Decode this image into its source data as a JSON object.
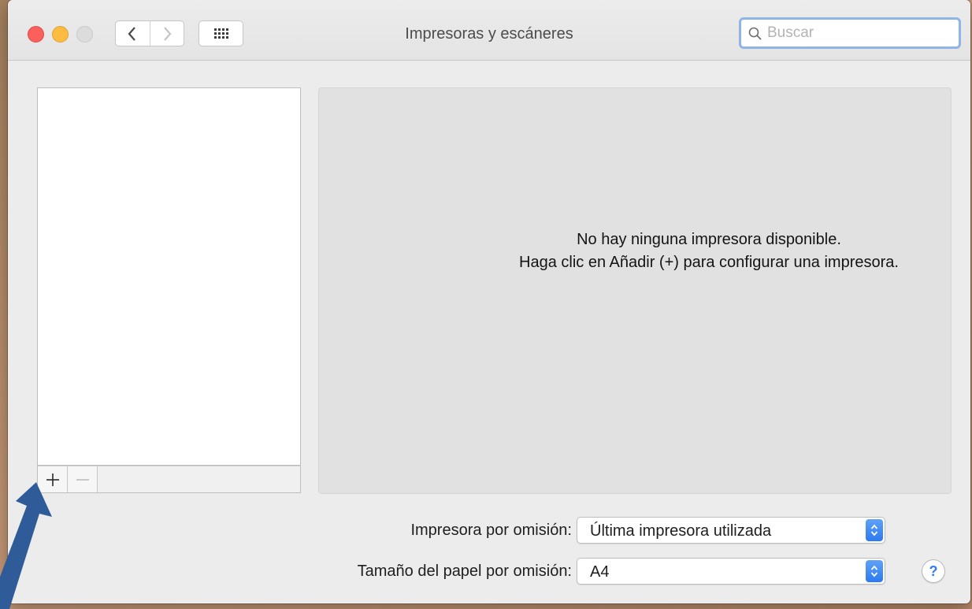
{
  "window": {
    "title": "Impresoras y escáneres"
  },
  "toolbar": {
    "back_icon": "chevron-left-icon",
    "forward_icon": "chevron-right-icon",
    "grid_icon": "show-all-grid-icon"
  },
  "search": {
    "icon": "search-icon",
    "placeholder": "Buscar",
    "value": ""
  },
  "printer_list": {
    "items": [],
    "add_label": "+",
    "remove_label": "—"
  },
  "detail": {
    "empty_line1": "No hay ninguna impresora disponible.",
    "empty_line2": "Haga clic en Añadir (+) para configurar una impresora."
  },
  "settings": {
    "default_printer_label": "Impresora por omisión:",
    "default_printer_value": "Última impresora utilizada",
    "paper_size_label": "Tamaño del papel por omisión:",
    "paper_size_value": "A4"
  },
  "help": {
    "label": "?"
  },
  "colors": {
    "accent": "#2d7af0",
    "close": "#fc605c",
    "minimize": "#fdbc40",
    "annotation_arrow": "#2f5c98"
  }
}
